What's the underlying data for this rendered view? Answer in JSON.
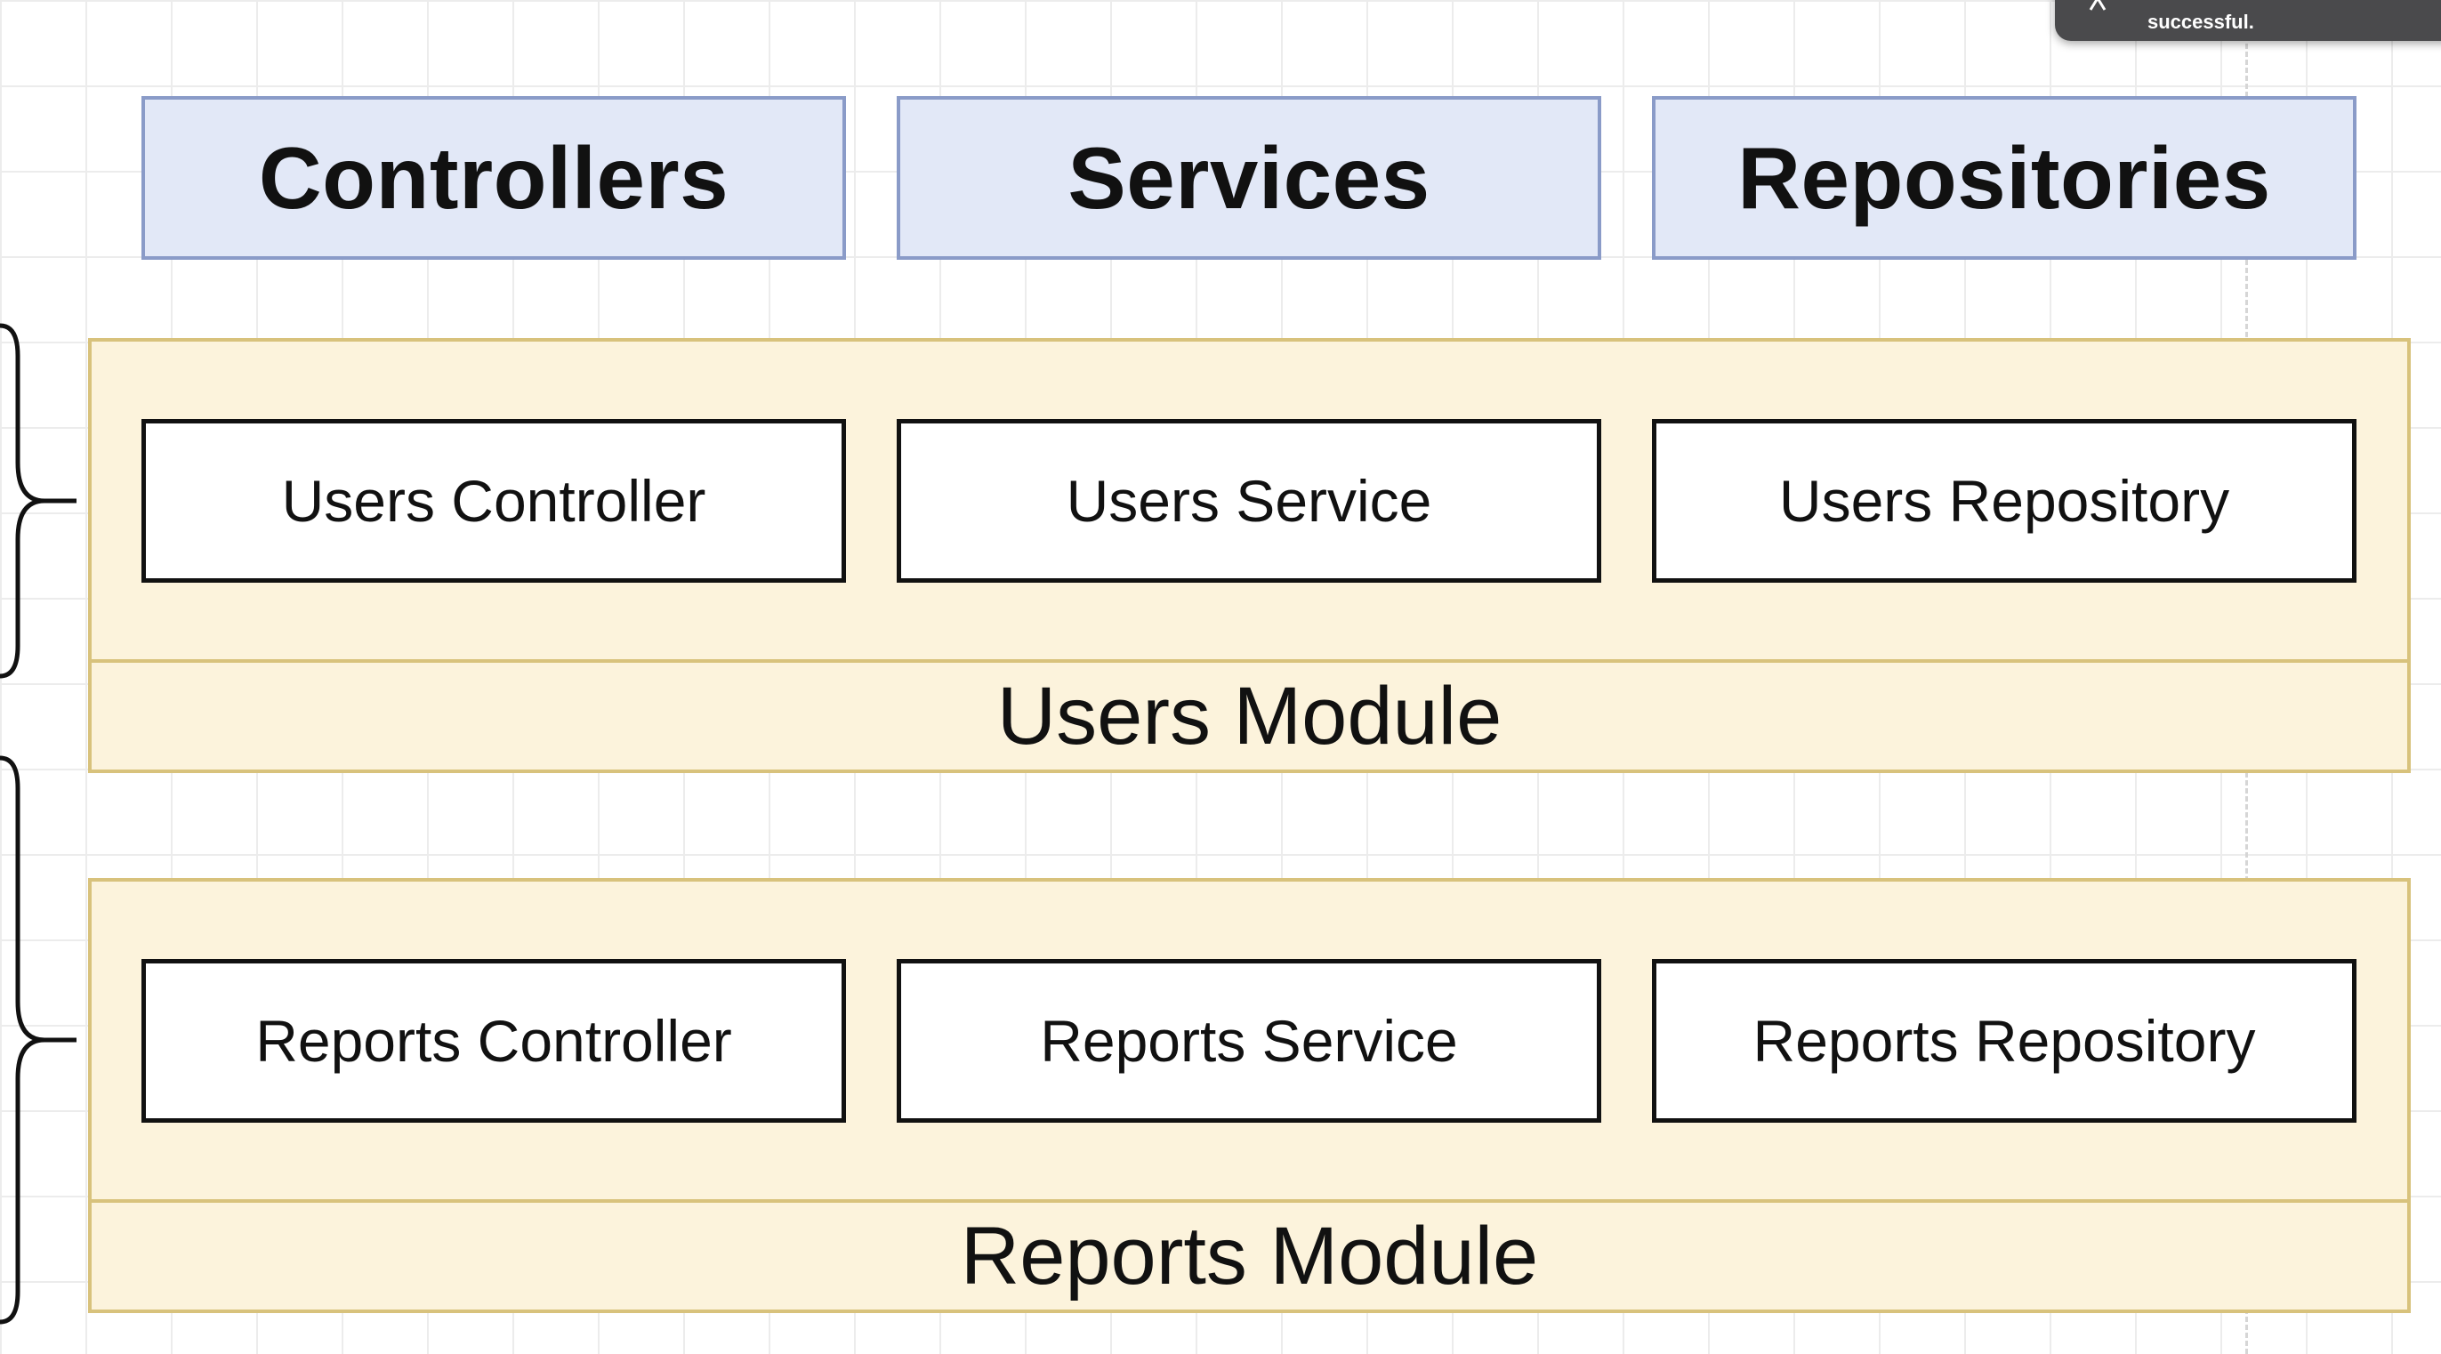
{
  "layers": [
    {
      "label": "Controllers"
    },
    {
      "label": "Services"
    },
    {
      "label": "Repositories"
    }
  ],
  "modules": [
    {
      "title": "Users Module",
      "items": [
        "Users Controller",
        "Users Service",
        "Users Repository"
      ]
    },
    {
      "title": "Reports Module",
      "items": [
        "Reports Controller",
        "Reports Service",
        "Reports Repository"
      ]
    }
  ],
  "notification": {
    "text": "successful."
  },
  "colors": {
    "layer_fill": "#e2e8f7",
    "layer_border": "#8a9bc8",
    "module_fill": "#fcf3dc",
    "module_border": "#d8c27c",
    "item_border": "#111111"
  }
}
